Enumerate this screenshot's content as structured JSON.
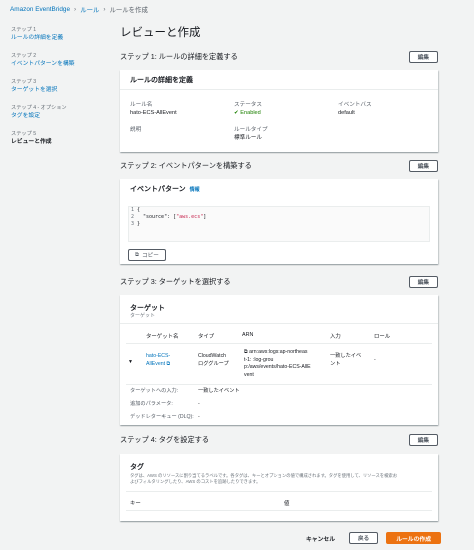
{
  "breadcrumb": {
    "root": "Amazon EventBridge",
    "rules": "ルール",
    "current": "ルールを作成"
  },
  "sidebar": [
    {
      "step": "ステップ 1",
      "label": "ルールの詳細を定義"
    },
    {
      "step": "ステップ 2",
      "label": "イベントパターンを構築"
    },
    {
      "step": "ステップ 3",
      "label": "ターゲットを選択"
    },
    {
      "step": "ステップ 4 - オプション",
      "label": "タグを設定"
    },
    {
      "step": "ステップ 5",
      "label": "レビューと作成"
    }
  ],
  "page_title": "レビューと作成",
  "edit_label": "編集",
  "step1": {
    "title": "ステップ 1: ルールの詳細を定義する",
    "panel_title": "ルールの詳細を定義",
    "name_label": "ルール名",
    "name": "hato-ECS-AllEvent",
    "status_label": "ステータス",
    "status": "Enabled",
    "bus_label": "イベントバス",
    "bus": "default",
    "desc_label": "説明",
    "type_label": "ルールタイプ",
    "type": "標準ルール"
  },
  "step2": {
    "title": "ステップ 2: イベントパターンを構築する",
    "panel_title": "イベントパターン",
    "info": "情報",
    "code": {
      "l1": "{",
      "l2_key": "\"source\": [",
      "l2_val": "\"aws.ecs\"",
      "l2_end": "]",
      "l3": "}"
    },
    "copy": "コピー"
  },
  "step3": {
    "title": "ステップ 3: ターゲットを選択する",
    "panel_title": "ターゲット",
    "panel_sub": "ターゲット",
    "headers": {
      "name": "ターゲット名",
      "type": "タイプ",
      "arn": "ARN",
      "input": "入力",
      "role": "ロール"
    },
    "row": {
      "name1": "hato-ECS-",
      "name2": "AllEvent",
      "type1": "CloudWatch",
      "type2": "ロググループ",
      "arn1": "arn:aws:logs:ap-northeas",
      "arn2": "t-1:              :log-grou",
      "arn3": "p:/aws/events/hato-ECS-AllE",
      "arn4": "vent",
      "input1": "一致したイベ",
      "input2": "ント",
      "role": "-"
    },
    "target_input_label": "ターゲットへの入力:",
    "target_input": "一致したイベント",
    "extra_label": "追加のパラメータ:",
    "extra": "-",
    "dlq_label": "デッドレターキュー (DLQ):",
    "dlq": "-"
  },
  "step4": {
    "title": "ステップ 4: タグを設定する",
    "panel_title": "タグ",
    "desc1": "タグは、AWS のリソースに割り当てるラベルです。各タグは、キーとオプションの値で構成されます。タグを使用して、リソースを検索お",
    "desc2": "よびフィルタリングしたり、AWS のコストを追跡したりできます。",
    "key_header": "キー",
    "value_header": "値"
  },
  "footer": {
    "cancel": "キャンセル",
    "back": "戻る",
    "create": "ルールの作成"
  }
}
